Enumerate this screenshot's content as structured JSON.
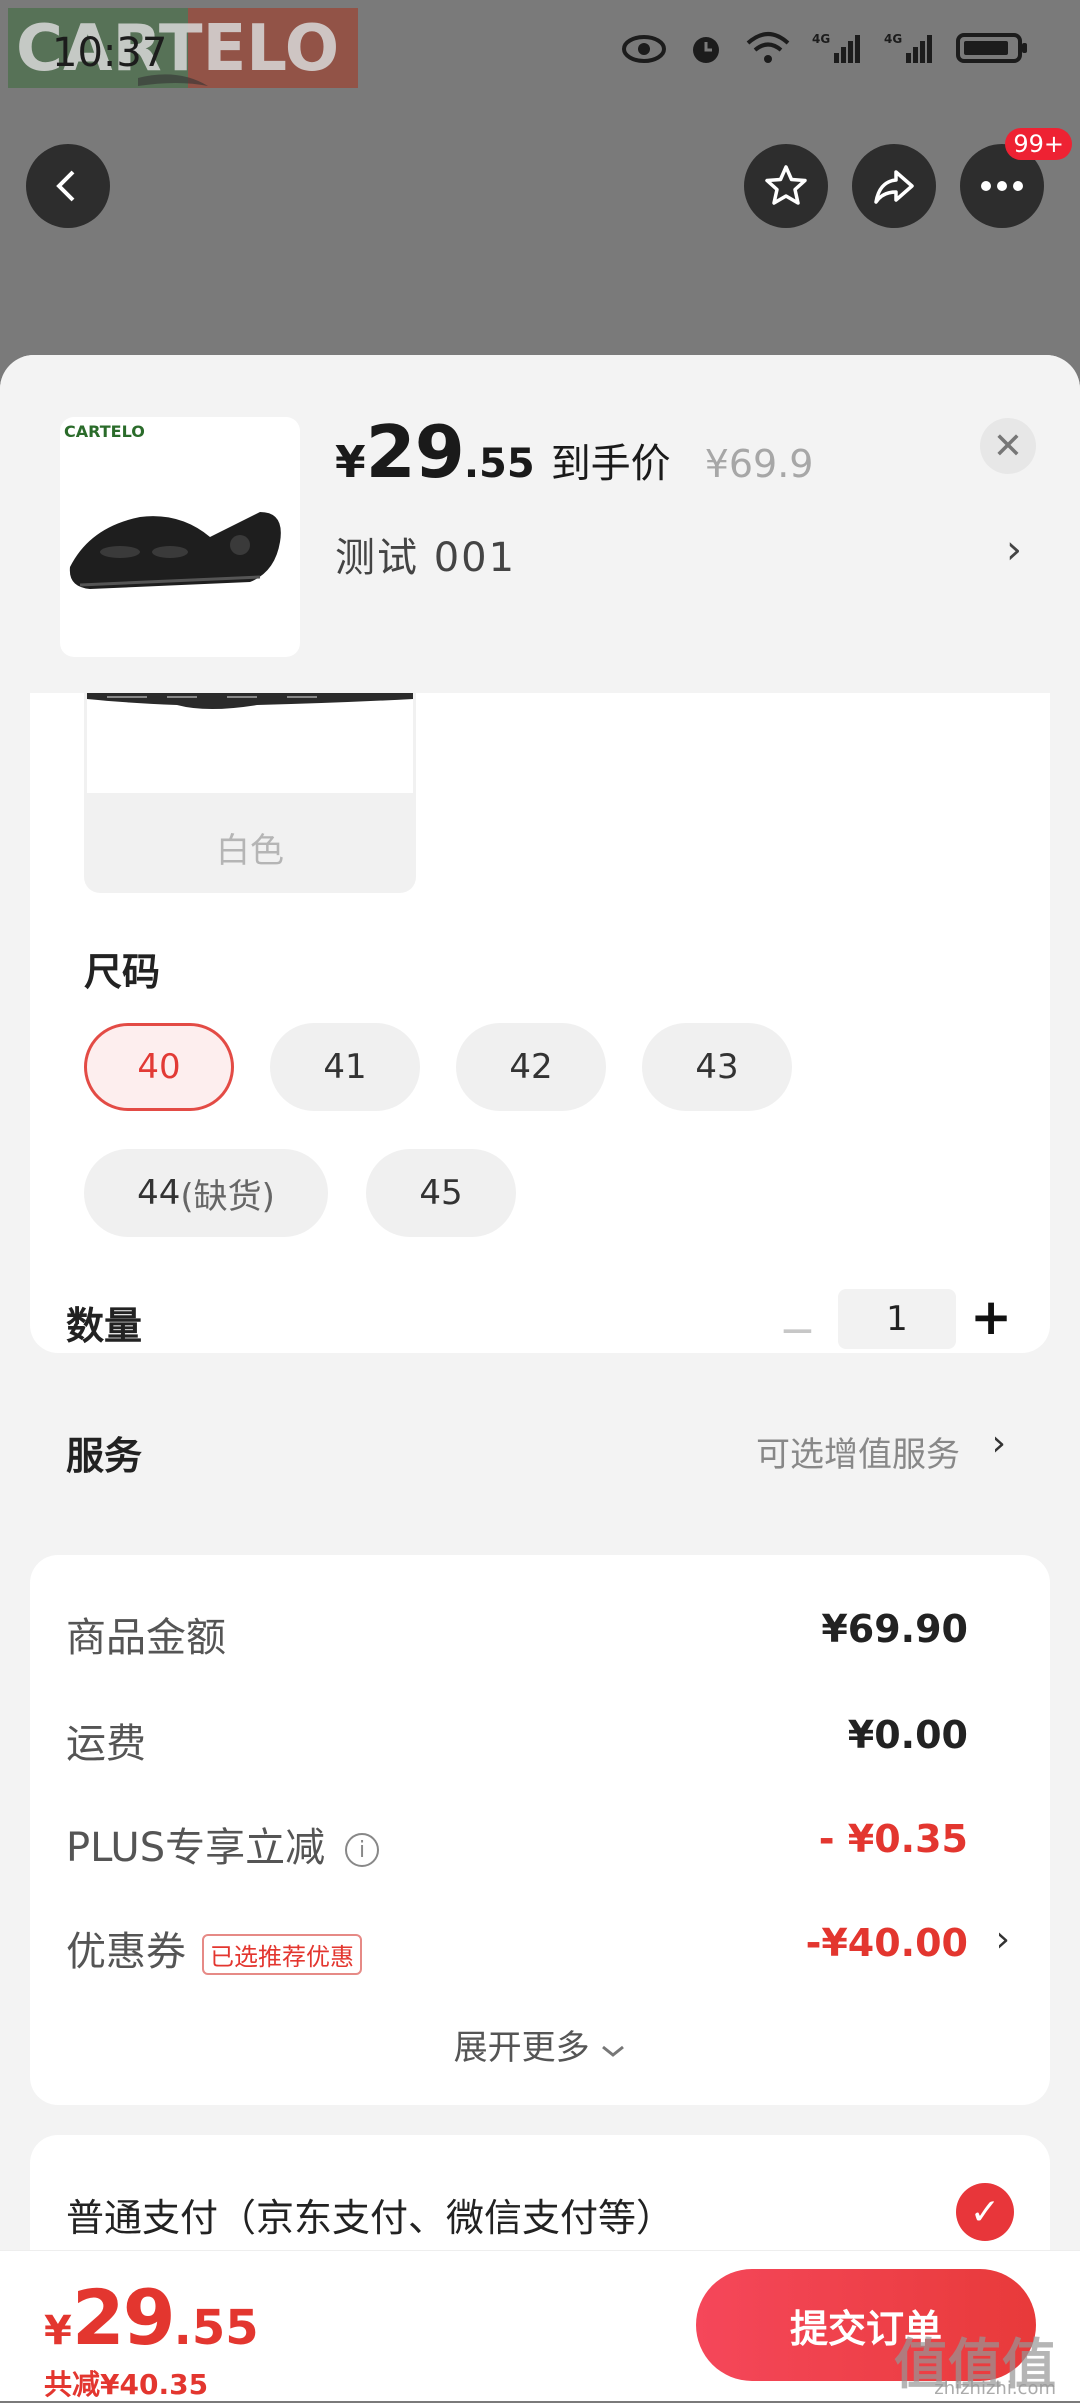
{
  "status_bar": {
    "time": "10:37",
    "icons": [
      "eye-icon",
      "alarm-icon",
      "wifi-icon",
      "signal-4g-icon",
      "signal-4g-icon",
      "battery-icon"
    ],
    "net1": "4G",
    "net2": "4G"
  },
  "background_page": {
    "logo_text": "CARTELO",
    "more_badge": "99+"
  },
  "header": {
    "price_currency": "¥",
    "price_integer": "29",
    "price_decimal": ".55",
    "price_tag": "到手价",
    "original_price": "¥69.9",
    "close_symbol": "✕",
    "variant_text": "测试  001",
    "variant_arrow": "›",
    "thumb_logo": "CARTELO"
  },
  "color_section": {
    "selected_color": "白色"
  },
  "size_section": {
    "title": "尺码",
    "options": [
      {
        "label": "40",
        "selected": true
      },
      {
        "label": "41",
        "selected": false
      },
      {
        "label": "42",
        "selected": false
      },
      {
        "label": "43",
        "selected": false
      },
      {
        "label": "44",
        "suffix": "(缺货)",
        "selected": false
      },
      {
        "label": "45",
        "selected": false
      }
    ]
  },
  "quantity": {
    "title": "数量",
    "minus": "−",
    "value": "1",
    "plus": "+"
  },
  "service": {
    "title": "服务",
    "value": "可选增值服务",
    "arrow": "›"
  },
  "price_breakdown": {
    "rows": [
      {
        "label": "商品金额",
        "value": "¥69.90"
      },
      {
        "label": "运费",
        "value": "¥0.00"
      },
      {
        "label": "PLUS专享立减",
        "value": "- ¥0.35",
        "info": "i"
      },
      {
        "label": "优惠券",
        "tag": "已选推荐优惠",
        "value": "-¥40.00",
        "arrow": "›"
      }
    ],
    "expand_label": "展开更多",
    "expand_icon": "chevron-down-icon"
  },
  "payment": {
    "label": "普通支付（京东支付、微信支付等）",
    "check": "✓"
  },
  "bottom_bar": {
    "total_currency": "¥",
    "total_integer": "29",
    "total_decimal": ".55",
    "saved": "共减¥40.35",
    "submit_label": "提交订单"
  },
  "watermark": {
    "text": "值值值",
    "sub": "zhizhizhi.com"
  },
  "colors": {
    "accent_red": "#e3362f",
    "overlay_gray": "#7a7a7a",
    "sheet_bg": "#f3f3f3"
  }
}
